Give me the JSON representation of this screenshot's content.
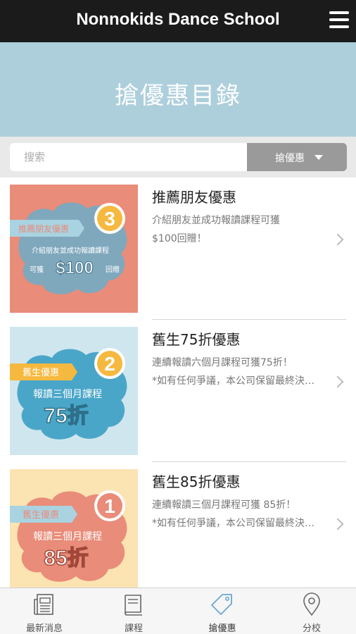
{
  "header": {
    "title": "Nonnokids Dance School",
    "menu_icon": "hamburger-menu-icon"
  },
  "banner": {
    "title": "搶優惠目錄"
  },
  "search": {
    "placeholder": "搜索",
    "filter_label": "搶優惠"
  },
  "offers": [
    {
      "title": "推薦朋友優惠",
      "desc_line1": "介紹朋友並成功報讀課程可獲",
      "desc_line2": "$100回贈！",
      "image": {
        "number": "3",
        "tag": "推薦朋友優惠",
        "line1": "介紹朋友並成功報讀課程",
        "line2": "可獲",
        "big": "$100",
        "suffix": "回贈",
        "bg": "#e98c7a",
        "cloud": "#7fa8bd",
        "ribbon": "#a9d3e1"
      }
    },
    {
      "title": "舊生75折優惠",
      "desc_line1": "連續報讀六個月課程可獲75折！",
      "desc_line2": "*如有任何爭議，本公司保留最終決定權",
      "image": {
        "number": "2",
        "tag": "舊生優惠",
        "line1": "報讀三個月課程",
        "big": "75折",
        "bg": "#cfe6ee",
        "cloud": "#4aa6c8",
        "ribbon": "#f5b93f"
      }
    },
    {
      "title": "舊生85折優惠",
      "desc_line1": "連續報讀三個月課程可獲 85折！",
      "desc_line2": "*如有任何爭議，本公司保留最終決定權",
      "image": {
        "number": "1",
        "tag": "舊生優惠",
        "line1": "報讀三個月課程",
        "big": "85折",
        "bg": "#fbe3b2",
        "cloud": "#e98c7a",
        "ribbon": "#a9d3e1"
      }
    }
  ],
  "tabbar": [
    {
      "label": "最新消息",
      "icon": "newspaper-icon"
    },
    {
      "label": "課程",
      "icon": "book-icon"
    },
    {
      "label": "搶優惠",
      "icon": "price-tag-icon",
      "active": true
    },
    {
      "label": "分校",
      "icon": "map-pin-icon"
    }
  ],
  "colors": {
    "header_bg": "#1b1b1b",
    "banner_bg": "#adcfdc",
    "active_tab": "#6aa8cf"
  }
}
